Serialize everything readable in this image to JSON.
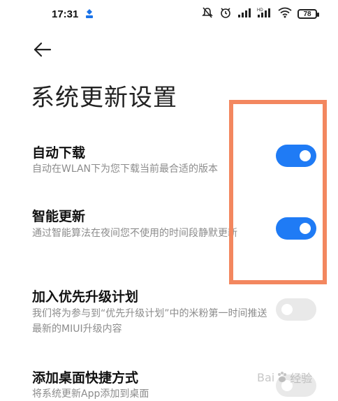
{
  "status_bar": {
    "time": "17:31",
    "battery": "78",
    "icons": [
      "app-notification-icon",
      "mute-icon",
      "alarm-icon",
      "signal-icon",
      "signal-hd-icon",
      "wifi-icon",
      "battery-icon"
    ]
  },
  "header": {
    "back_icon": "back-arrow-icon",
    "title": "系统更新设置"
  },
  "settings": [
    {
      "title": "自动下载",
      "description": "自动在WLAN下为您下载当前最合适的版本",
      "toggle": "on"
    },
    {
      "title": "智能更新",
      "description": "通过智能算法在夜间您不使用的时间段静默更新",
      "toggle": "on"
    },
    {
      "title": "加入优先升级计划",
      "description": "我们将为参与到“优先升级计划”中的米粉第一时间推送最新的MIUI升级内容",
      "toggle": "off"
    },
    {
      "title": "添加桌面快捷方式",
      "description": "将系统更新App添加到桌面",
      "toggle": "off"
    }
  ],
  "watermark": {
    "text": "经验",
    "logo": "Bai"
  },
  "colors": {
    "toggle_on": "#1f7bf5",
    "toggle_off": "#e9e9e9",
    "highlight": "#f3875f",
    "description": "#8c8c8c"
  }
}
